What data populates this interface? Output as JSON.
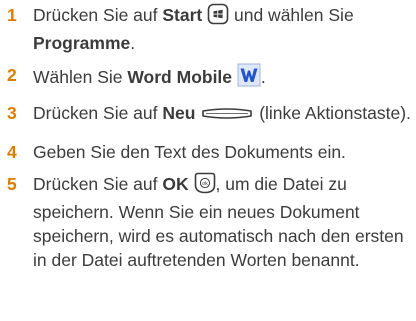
{
  "steps": [
    {
      "number": "1",
      "parts": [
        "Drücken Sie auf ",
        "Start",
        " und wählen Sie ",
        "Programme",
        "."
      ],
      "icon": "start-button-icon"
    },
    {
      "number": "2",
      "parts": [
        "Wählen Sie ",
        "Word Mobile",
        "."
      ],
      "icon": "word-mobile-icon"
    },
    {
      "number": "3",
      "parts": [
        "Drücken Sie auf ",
        "Neu",
        " (linke Aktionstaste)."
      ],
      "icon": "left-action-key-icon"
    },
    {
      "number": "4",
      "parts": [
        "Geben Sie den Text des Dokuments ein."
      ]
    },
    {
      "number": "5",
      "parts": [
        "Drücken Sie auf ",
        "OK",
        ", um die Datei zu speichern. Wenn Sie ein neues Dokument speichern, wird es automatisch nach den ersten in der Datei auftretenden Worten benannt."
      ],
      "icon": "ok-button-icon"
    }
  ],
  "colors": {
    "step_number": "#e07b00",
    "text": "#3c3c3c",
    "word_icon": "#2255cc"
  }
}
